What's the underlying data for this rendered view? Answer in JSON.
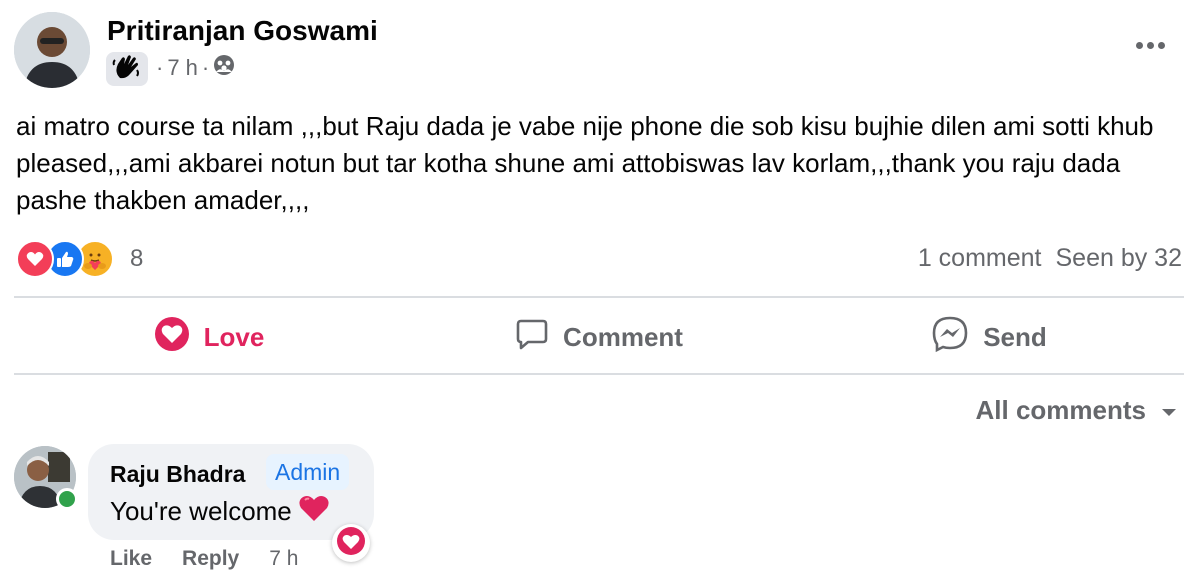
{
  "post": {
    "author": "Pritiranjan Goswami",
    "time": "7 h",
    "meta_sep": "·",
    "privacy_icon": "group-icon",
    "text": "ai matro course ta nilam ,,,but Raju dada je vabe nije phone die sob kisu bujhie dilen ami sotti khub pleased,,,ami akbarei notun but tar kotha shune ami attobiswas lav korlam,,,thank you raju dada pashe thakben amader,,,,"
  },
  "reactions": {
    "types": [
      "love",
      "like",
      "care"
    ],
    "count": "8",
    "comments": "1 comment",
    "seen": "Seen by 32"
  },
  "actions": {
    "love": "Love",
    "comment": "Comment",
    "send": "Send"
  },
  "comments_filter": "All comments",
  "comment": {
    "author": "Raju Bhadra",
    "role": "Admin",
    "text": "You're welcome",
    "like": "Like",
    "reply": "Reply",
    "time": "7 h"
  },
  "colors": {
    "love": "#e0245e",
    "like": "#1877f2",
    "admin_text": "#1b74e4",
    "online": "#31a24c"
  }
}
